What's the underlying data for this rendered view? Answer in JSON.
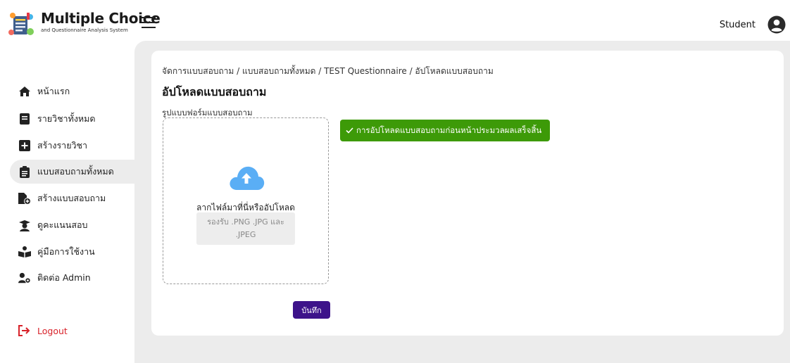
{
  "header": {
    "app_title": "Multiple Choice",
    "app_subtitle": "and Questionnaire Analysis System",
    "user_label": "Student"
  },
  "sidebar": {
    "items": [
      {
        "label": "หน้าแรก",
        "icon": "home-icon"
      },
      {
        "label": "รายวิชาทั้งหมด",
        "icon": "book-icon"
      },
      {
        "label": "สร้างรายวิชา",
        "icon": "plus-square-icon"
      },
      {
        "label": "แบบสอบถามทั้งหมด",
        "icon": "clipboard-icon",
        "active": true
      },
      {
        "label": "สร้างแบบสอบถาม",
        "icon": "file-plus-icon"
      },
      {
        "label": "ดูคะแนนสอบ",
        "icon": "graduate-icon"
      },
      {
        "label": "คู่มือการใช้งาน",
        "icon": "reading-icon"
      },
      {
        "label": "ติดต่อ Admin",
        "icon": "user-gear-icon"
      }
    ],
    "logout_label": "Logout"
  },
  "main": {
    "breadcrumb": "จัดการแบบสอบถาม / แบบสอบถามทั้งหมด / TEST Questionnaire / อัปโหลดแบบสอบถาม",
    "page_title": "อัปโหลดแบบสอบถาม",
    "field_label": "รูปแบบฟอร์มแบบสอบถาม",
    "dropzone_text": "ลากไฟล์มาที่นี่หรืออัปโหลด",
    "supported_formats": "รองรับ .PNG .JPG และ .JPEG",
    "success_message": "การอัปโหลดแบบสอบถามก่อนหน้าประมวลผลเสร็จสิ้น",
    "save_label": "บันทึก"
  },
  "colors": {
    "accent": "#3d138a",
    "success": "#3d9a08",
    "cloud": "#5aaef5",
    "logout": "#d8222a"
  }
}
